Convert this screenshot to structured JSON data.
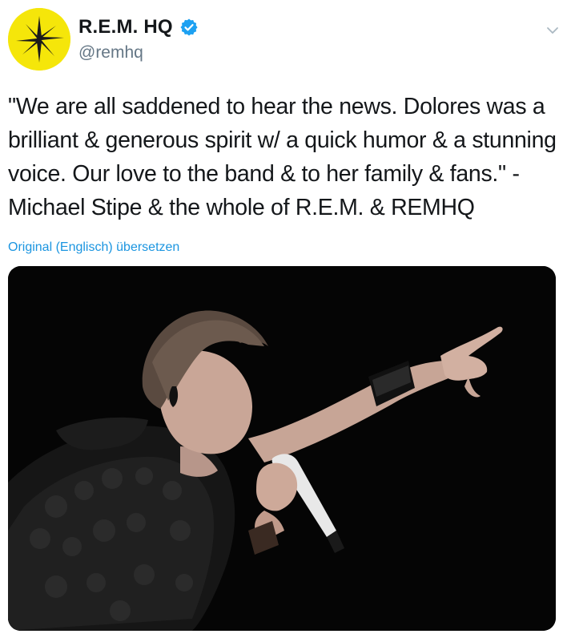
{
  "user": {
    "display_name": "R.E.M. HQ",
    "handle": "@remhq",
    "verified": true,
    "avatar_icon": "rem-star-logo-icon",
    "avatar_bg": "#f5e60a"
  },
  "tweet": {
    "lines": [
      "\"We are all saddened to hear the news. Dolores was a",
      "brilliant & generous spirit w/ a quick humor & a stunning",
      "voice. Our love to the band & to her family & fans.\" -",
      "Michael Stipe & the whole of R.E.M. & REMHQ"
    ],
    "translate_label": "Original (Englisch) übersetzen"
  },
  "icons": {
    "verified": "verified-badge-icon",
    "menu": "chevron-down-icon"
  },
  "colors": {
    "link": "#1b95e0",
    "handle": "#657786",
    "verified": "#1da1f2"
  }
}
